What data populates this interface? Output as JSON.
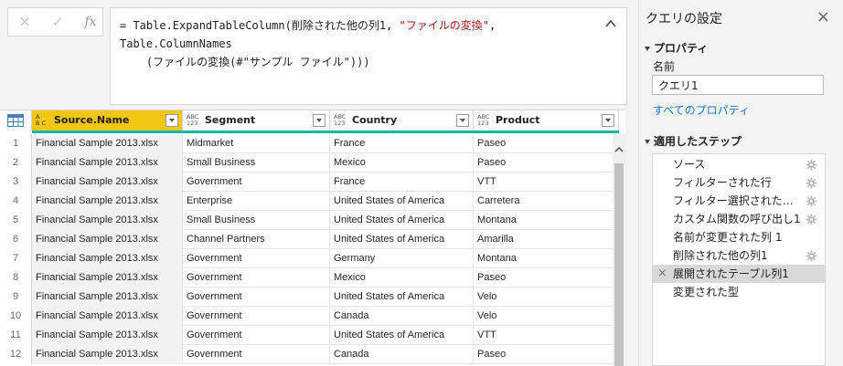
{
  "formula_bar": {
    "cancel_icon": "×",
    "commit_icon": "✓",
    "fx_label": "fx",
    "formula_line1_pre": "= Table.ExpandTableColumn(削除された他の列1, ",
    "formula_line1_str": "\"ファイルの変換\"",
    "formula_line1_post": ", Table.ColumnNames",
    "formula_line2": "    (ファイルの変換(#\"サンプル ファイル\")))"
  },
  "grid": {
    "columns": [
      {
        "label": "Source.Name",
        "type_icon_top": "A",
        "type_icon_bottom": "B C",
        "selected": true
      },
      {
        "label": "Segment",
        "type_icon_top": "ABC",
        "type_icon_bottom": "123",
        "selected": false
      },
      {
        "label": "Country",
        "type_icon_top": "ABC",
        "type_icon_bottom": "123",
        "selected": false
      },
      {
        "label": "Product",
        "type_icon_top": "ABC",
        "type_icon_bottom": "123",
        "selected": false
      }
    ],
    "rows": [
      [
        "1",
        "Financial Sample 2013.xlsx",
        "Midmarket",
        "France",
        "Paseo"
      ],
      [
        "2",
        "Financial Sample 2013.xlsx",
        "Small Business",
        "Mexico",
        "Paseo"
      ],
      [
        "3",
        "Financial Sample 2013.xlsx",
        "Government",
        "France",
        "VTT"
      ],
      [
        "4",
        "Financial Sample 2013.xlsx",
        "Enterprise",
        "United States of America",
        "Carretera"
      ],
      [
        "5",
        "Financial Sample 2013.xlsx",
        "Small Business",
        "United States of America",
        "Montana"
      ],
      [
        "6",
        "Financial Sample 2013.xlsx",
        "Channel Partners",
        "United States of America",
        "Amarilla"
      ],
      [
        "7",
        "Financial Sample 2013.xlsx",
        "Government",
        "Germany",
        "Montana"
      ],
      [
        "8",
        "Financial Sample 2013.xlsx",
        "Government",
        "Mexico",
        "Paseo"
      ],
      [
        "9",
        "Financial Sample 2013.xlsx",
        "Government",
        "United States of America",
        "Velo"
      ],
      [
        "10",
        "Financial Sample 2013.xlsx",
        "Government",
        "Canada",
        "Velo"
      ],
      [
        "11",
        "Financial Sample 2013.xlsx",
        "Government",
        "United States of America",
        "VTT"
      ],
      [
        "12",
        "Financial Sample 2013.xlsx",
        "Government",
        "Canada",
        "Paseo"
      ]
    ]
  },
  "settings": {
    "title": "クエリの設定",
    "close_icon": "×",
    "properties_heading": "プロパティ",
    "name_label": "名前",
    "name_value": "クエリ1",
    "all_properties_link": "すべてのプロパティ",
    "applied_steps_heading": "適用したステップ",
    "steps": [
      {
        "label": "ソース",
        "gear": true,
        "selected": false
      },
      {
        "label": "フィルターされた行",
        "gear": true,
        "selected": false
      },
      {
        "label": "フィルター選択された…",
        "gear": true,
        "selected": false
      },
      {
        "label": "カスタム関数の呼び出し1",
        "gear": true,
        "selected": false
      },
      {
        "label": "名前が変更された列 1",
        "gear": false,
        "selected": false
      },
      {
        "label": "削除された他の列1",
        "gear": true,
        "selected": false
      },
      {
        "label": "展開されたテーブル列1",
        "gear": false,
        "selected": true
      },
      {
        "label": "変更された型",
        "gear": false,
        "selected": false
      }
    ],
    "delete_step_icon": "×"
  },
  "colors": {
    "selected_column_header": "#f3c613",
    "column_quality_bar": "#14b7a8",
    "link": "#1a73c8",
    "formula_string": "#a31515"
  }
}
